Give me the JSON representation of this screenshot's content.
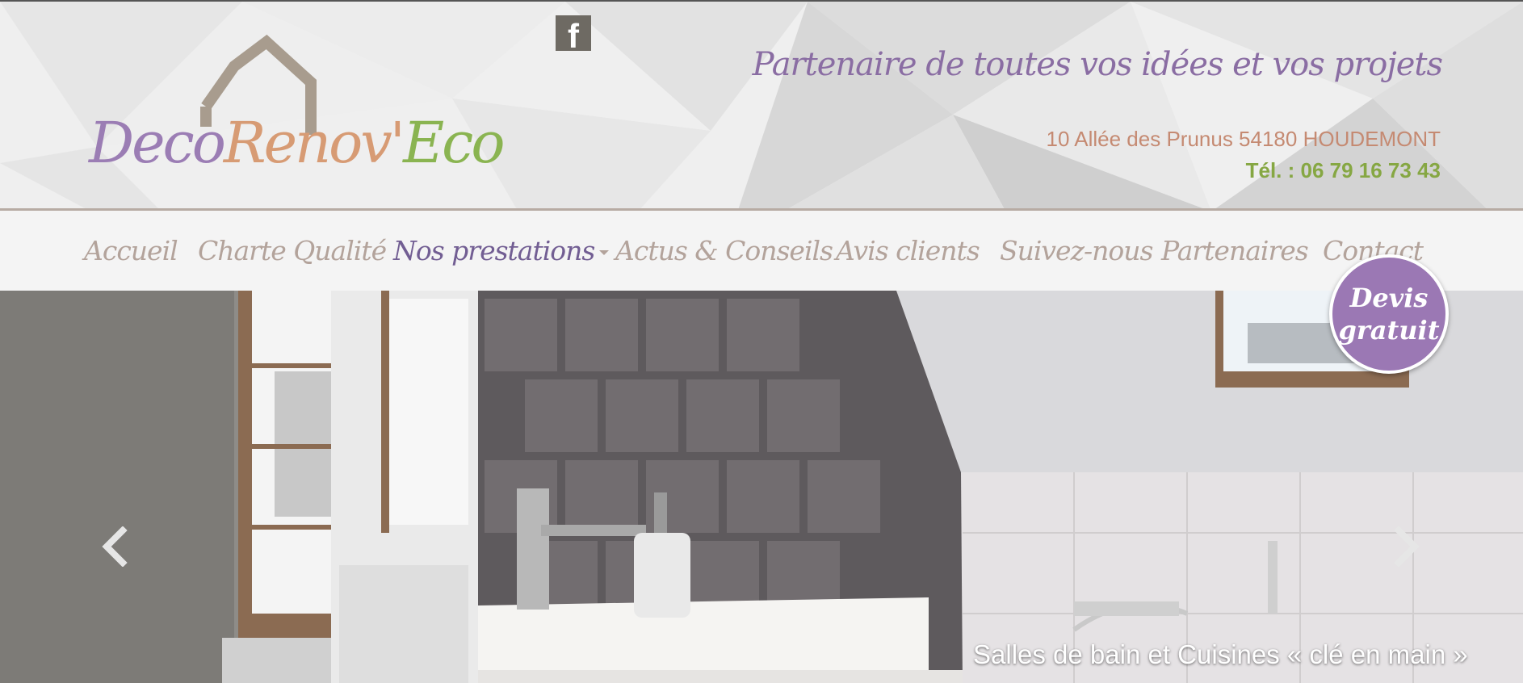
{
  "header": {
    "logo": {
      "part1": "Deco",
      "part2": "Renov'",
      "part3": "Eco"
    },
    "facebook_icon": "facebook-icon",
    "tagline": "Partenaire de toutes vos idées et vos projets",
    "address": "10 Allée des Prunus 54180 HOUDEMONT",
    "phone": "Tél. : 06 79 16 73 43"
  },
  "nav": {
    "items": [
      {
        "label": "Accueil"
      },
      {
        "label": "Charte Qualité"
      },
      {
        "label": "Nos prestations"
      },
      {
        "label": "Actus & Conseils"
      },
      {
        "label": "Avis clients"
      },
      {
        "label": "Suivez-nous"
      },
      {
        "label": "Partenaires"
      },
      {
        "label": "Contact"
      }
    ]
  },
  "devis": {
    "line1": "Devis",
    "line2": "gratuit"
  },
  "slider": {
    "caption": "Salles de bain et Cuisines « clé en main »",
    "prev_icon": "chevron-left-icon",
    "next_icon": "chevron-right-icon"
  },
  "colors": {
    "brand_purple": "#8a6da3",
    "brand_orange": "#c58a72",
    "brand_green": "#86a743",
    "nav_text": "#b3a39b"
  }
}
